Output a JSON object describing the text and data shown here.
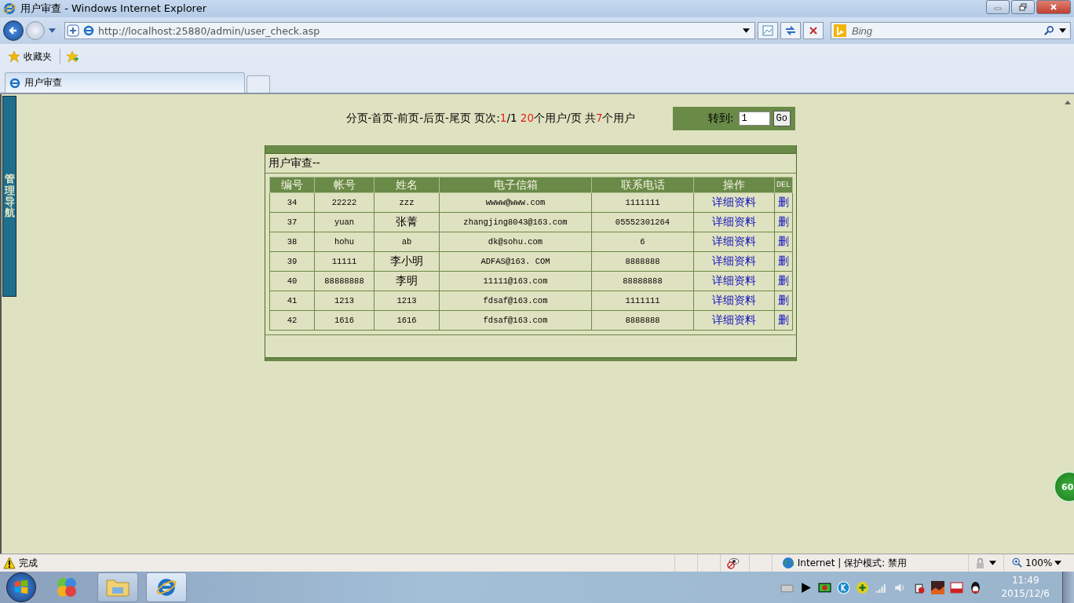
{
  "window": {
    "title": "用户审查 - Windows Internet Explorer"
  },
  "address": {
    "url": "http://localhost:25880/admin/user_check.asp"
  },
  "search": {
    "placeholder": "Bing"
  },
  "favorites": {
    "label": "收藏夹"
  },
  "tabs": [
    {
      "label": "用户审查",
      "selected": true
    }
  ],
  "sidebar": {
    "label": "管理导航"
  },
  "pager": [
    {
      "text": "分页-首页-前页-后页-尾页  页次:",
      "highlight": false
    },
    {
      "text": "1",
      "highlight": true
    },
    {
      "text": "/1 ",
      "highlight": false
    },
    {
      "text": "20",
      "highlight": true
    },
    {
      "text": "个用户/页 共",
      "highlight": false
    },
    {
      "text": "7",
      "highlight": true
    },
    {
      "text": "个用户",
      "highlight": false
    }
  ],
  "goto": {
    "label": "转到:",
    "value": "1",
    "button": "Go"
  },
  "panel": {
    "title": "用户审查--",
    "columns": [
      "编号",
      "帐号",
      "姓名",
      "电子信箱",
      "联系电话",
      "操作",
      "DEL"
    ],
    "rows": [
      {
        "cells": [
          "34",
          "22222",
          "zzz",
          "wwww@www.com",
          "1111111"
        ],
        "action": "详细资料",
        "delete": "删"
      },
      {
        "cells": [
          "37",
          "yuan",
          "张菁",
          "zhangjing8043@163.com",
          "05552301264"
        ],
        "action": "详细资料",
        "delete": "删"
      },
      {
        "cells": [
          "38",
          "hohu",
          "ab",
          "dk@sohu.com",
          "6"
        ],
        "action": "详细资料",
        "delete": "删"
      },
      {
        "cells": [
          "39",
          "11111",
          "李小明",
          "ADFAS@163. COM",
          "8888888"
        ],
        "action": "详细资料",
        "delete": "删"
      },
      {
        "cells": [
          "40",
          "88888888",
          "李明",
          "11111@163.com",
          "88888888"
        ],
        "action": "详细资料",
        "delete": "删"
      },
      {
        "cells": [
          "41",
          "1213",
          "1213",
          "fdsaf@163.com",
          "1111111"
        ],
        "action": "详细资料",
        "delete": "删"
      },
      {
        "cells": [
          "42",
          "1616",
          "1616",
          "fdsaf@163.com",
          "8888888"
        ],
        "action": "详细资料",
        "delete": "删"
      }
    ]
  },
  "float_badge": "60",
  "status": {
    "text": "完成",
    "zone": "Internet | 保护模式: 禁用",
    "zoom": "100%"
  },
  "taskbar": {
    "time": "11:49",
    "date": "2015/12/6"
  }
}
